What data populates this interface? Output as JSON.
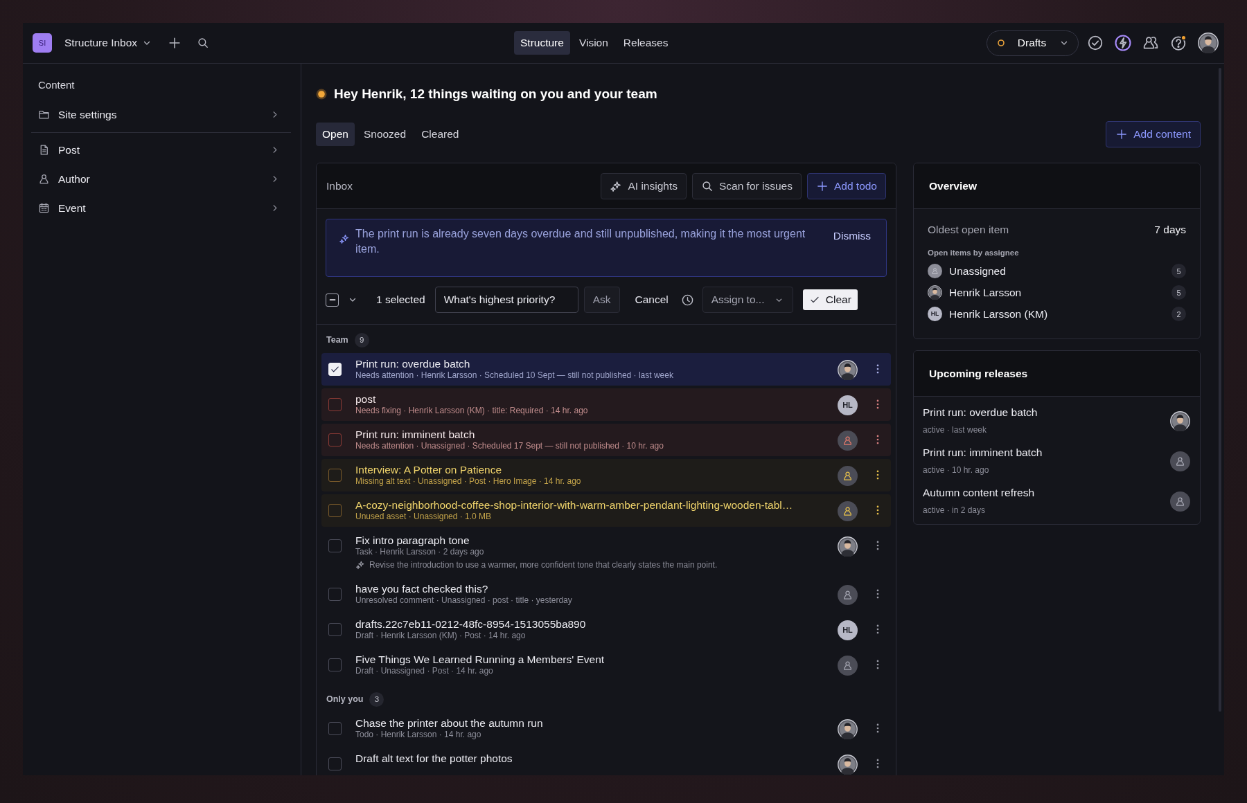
{
  "workspace": {
    "badge": "SI",
    "name": "Structure Inbox"
  },
  "nav": [
    {
      "label": "Structure",
      "selected": true
    },
    {
      "label": "Vision",
      "selected": false
    },
    {
      "label": "Releases",
      "selected": false
    }
  ],
  "perspective": {
    "label": "Drafts"
  },
  "sidebar": {
    "heading": "Content",
    "sections": [
      {
        "items": [
          {
            "label": "Site settings",
            "kind": "folder"
          }
        ]
      },
      {
        "items": [
          {
            "label": "Post",
            "kind": "document"
          },
          {
            "label": "Author",
            "kind": "person"
          },
          {
            "label": "Event",
            "kind": "calendar"
          }
        ]
      }
    ]
  },
  "greeting": "Hey Henrik, 12 things waiting on you and your team",
  "tabs": [
    {
      "label": "Open",
      "selected": true
    },
    {
      "label": "Snoozed",
      "selected": false
    },
    {
      "label": "Cleared",
      "selected": false
    }
  ],
  "add_content": "Add content",
  "inbox": {
    "title": "Inbox",
    "actions": [
      {
        "label": "AI insights",
        "kind": "ai"
      },
      {
        "label": "Scan for issues",
        "kind": "scan"
      },
      {
        "label": "Add todo",
        "kind": "add"
      }
    ],
    "insight": {
      "text": "The print run is already seven days overdue and still unpublished, making it the most urgent item.",
      "dismiss": "Dismiss"
    },
    "toolbar": {
      "indeterminate": true,
      "selected_count": "1 selected",
      "question": "What's highest priority?",
      "ask": {
        "label": "Ask",
        "disabled": true
      },
      "cancel": "Cancel",
      "assign": "Assign to...",
      "clear": "Clear"
    },
    "groups": [
      {
        "label": "Team",
        "count": "9",
        "rows": [
          {
            "title": "Print run: overdue batch",
            "meta": "Needs attention · Henrik Larsson · Scheduled 10 Sept — still not published · last week",
            "kind": "normal",
            "checked": true,
            "avatar": {
              "kind": "photo"
            }
          },
          {
            "title": "post",
            "meta": "Needs fixing · Henrik Larsson (KM) · title: Required · 14 hr. ago",
            "kind": "critical",
            "checked": false,
            "avatar": {
              "kind": "initials",
              "initials": "HL"
            }
          },
          {
            "title": "Print run: imminent batch",
            "meta": "Needs attention · Unassigned · Scheduled 17 Sept — still not published · 10 hr. ago",
            "kind": "critical",
            "checked": false,
            "avatar": {
              "kind": "none"
            }
          },
          {
            "title": "Interview: A Potter on Patience",
            "meta": "Missing alt text · Unassigned · Post · Hero Image · 14 hr. ago",
            "kind": "warning",
            "checked": false,
            "avatar": {
              "kind": "none"
            }
          },
          {
            "title": "A-cozy-neighborhood-coffee-shop-interior-with-warm-amber-pendant-lighting-wooden-tabl…",
            "meta": "Unused asset · Unassigned · 1.0 MB",
            "kind": "warning",
            "checked": false,
            "avatar": {
              "kind": "none"
            }
          },
          {
            "title": "Fix intro paragraph tone",
            "meta": "Task · Henrik Larsson · 2 days ago",
            "note": "Revise the introduction to use a warmer, more confident tone that clearly states the main point.",
            "kind": "normal",
            "checked": false,
            "avatar": {
              "kind": "photo"
            }
          },
          {
            "title": "have you fact checked this?",
            "meta": "Unresolved comment · Unassigned · post · title · yesterday",
            "kind": "normal",
            "checked": false,
            "avatar": {
              "kind": "none"
            }
          },
          {
            "title": "drafts.22c7eb11-0212-48fc-8954-1513055ba890",
            "meta": "Draft · Henrik Larsson (KM) · Post · 14 hr. ago",
            "kind": "normal",
            "checked": false,
            "avatar": {
              "kind": "initials",
              "initials": "HL"
            }
          },
          {
            "title": "Five Things We Learned Running a Members' Event",
            "meta": "Draft · Unassigned · Post · 14 hr. ago",
            "kind": "normal",
            "checked": false,
            "avatar": {
              "kind": "none"
            }
          }
        ]
      },
      {
        "label": "Only you",
        "count": "3",
        "rows": [
          {
            "title": "Chase the printer about the autumn run",
            "meta": "Todo · Henrik Larsson · 14 hr. ago",
            "kind": "normal",
            "checked": false,
            "avatar": {
              "kind": "photo"
            }
          },
          {
            "title": "Draft alt text for the potter photos",
            "kind": "normal",
            "checked": false,
            "avatar": {
              "kind": "photo"
            }
          }
        ]
      }
    ]
  },
  "overview": {
    "title": "Overview",
    "oldest_label": "Oldest open item",
    "oldest_value": "7 days",
    "assignee_heading": "Open items by assignee",
    "assignees": [
      {
        "name": "Unassigned",
        "avatar": {
          "kind": "none"
        },
        "count": "5"
      },
      {
        "name": "Henrik Larsson",
        "avatar": {
          "kind": "photo"
        },
        "count": "5"
      },
      {
        "name": "Henrik Larsson (KM)",
        "avatar": {
          "kind": "initials",
          "initials": "HL"
        },
        "count": "2"
      }
    ]
  },
  "releases": {
    "title": "Upcoming releases",
    "items": [
      {
        "title": "Print run: overdue batch",
        "meta": "active · last week",
        "avatar": {
          "kind": "photo"
        }
      },
      {
        "title": "Print run: imminent batch",
        "meta": "active · 10 hr. ago",
        "avatar": {
          "kind": "none"
        }
      },
      {
        "title": "Autumn content refresh",
        "meta": "active · in 2 days",
        "avatar": {
          "kind": "none"
        }
      }
    ]
  }
}
